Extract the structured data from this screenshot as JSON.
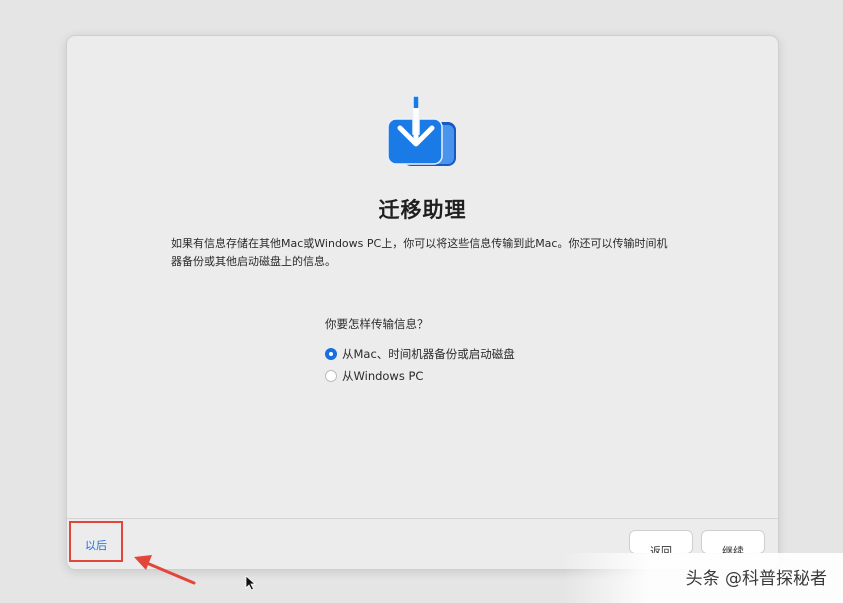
{
  "dialog": {
    "title": "迁移助理",
    "description": "如果有信息存储在其他Mac或Windows PC上，你可以将这些信息传输到此Mac。你还可以传输时间机器备份或其他启动磁盘上的信息。",
    "question": "你要怎样传输信息？",
    "options": [
      {
        "label": "从Mac、时间机器备份或启动磁盘",
        "selected": true
      },
      {
        "label": "从Windows PC",
        "selected": false
      }
    ],
    "later_label": "以后",
    "back_label": "返回",
    "continue_label": "继续"
  },
  "colors": {
    "accent": "#1a6fe0",
    "annotation": "#e2463a"
  },
  "icons": [
    "migration-assistant-icon",
    "annotation-arrow-icon",
    "mouse-cursor-icon"
  ],
  "watermark": "头条 @科普探秘者"
}
